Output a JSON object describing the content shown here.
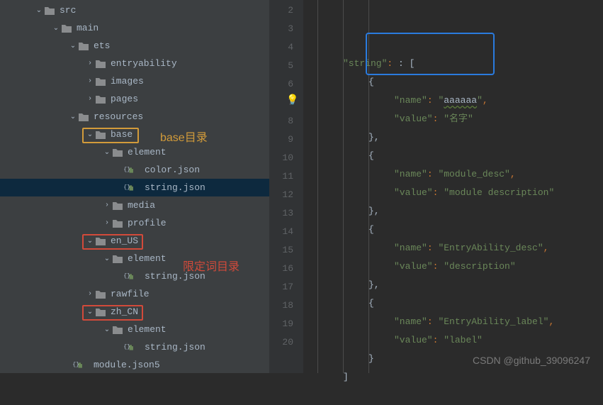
{
  "tree": {
    "rows": [
      {
        "indent": 48,
        "chev": "down",
        "icon": "folder",
        "label": "src"
      },
      {
        "indent": 72,
        "chev": "down",
        "icon": "folder",
        "label": "main"
      },
      {
        "indent": 96,
        "chev": "down",
        "icon": "folder",
        "label": "ets"
      },
      {
        "indent": 120,
        "chev": "right",
        "icon": "folder",
        "label": "entryability"
      },
      {
        "indent": 120,
        "chev": "right",
        "icon": "folder",
        "label": "images"
      },
      {
        "indent": 120,
        "chev": "right",
        "icon": "folder",
        "label": "pages"
      },
      {
        "indent": 96,
        "chev": "down",
        "icon": "folder",
        "label": "resources"
      },
      {
        "indent": 120,
        "chev": "down",
        "icon": "folder",
        "label": "base"
      },
      {
        "indent": 144,
        "chev": "down",
        "icon": "folder",
        "label": "element"
      },
      {
        "indent": 168,
        "chev": "none",
        "icon": "json",
        "label": "color.json"
      },
      {
        "indent": 168,
        "chev": "none",
        "icon": "json",
        "label": "string.json",
        "selected": true
      },
      {
        "indent": 144,
        "chev": "right",
        "icon": "folder",
        "label": "media"
      },
      {
        "indent": 144,
        "chev": "right",
        "icon": "folder",
        "label": "profile"
      },
      {
        "indent": 120,
        "chev": "down",
        "icon": "folder",
        "label": "en_US"
      },
      {
        "indent": 144,
        "chev": "down",
        "icon": "folder",
        "label": "element"
      },
      {
        "indent": 168,
        "chev": "none",
        "icon": "json",
        "label": "string.json"
      },
      {
        "indent": 120,
        "chev": "right",
        "icon": "folder",
        "label": "rawfile"
      },
      {
        "indent": 120,
        "chev": "down",
        "icon": "folder",
        "label": "zh_CN"
      },
      {
        "indent": 144,
        "chev": "down",
        "icon": "folder",
        "label": "element"
      },
      {
        "indent": 168,
        "chev": "none",
        "icon": "json",
        "label": "string.json"
      },
      {
        "indent": 96,
        "chev": "none",
        "icon": "json5",
        "label": "module.json5"
      }
    ],
    "annotations": {
      "base_label": "base目录",
      "en_us_label": "限定词目录"
    }
  },
  "editor": {
    "lines": [
      "2",
      "3",
      "4",
      "5",
      "6",
      "7",
      "8",
      "9",
      "10",
      "11",
      "12",
      "13",
      "14",
      "15",
      "16",
      "17",
      "18",
      "19",
      "20"
    ],
    "content": {
      "l2": {
        "indent": 2,
        "key": "string",
        "after": ": ["
      },
      "l3": {
        "indent": 4,
        "text": "{"
      },
      "l4": {
        "indent": 6,
        "key": "name",
        "val": "aaaaaa",
        "comma": true,
        "bulb": true,
        "selected": true
      },
      "l5": {
        "indent": 6,
        "key": "value",
        "val": "名字"
      },
      "l6": {
        "indent": 4,
        "text": "},"
      },
      "l7": {
        "indent": 4,
        "text": "{"
      },
      "l8": {
        "indent": 6,
        "key": "name",
        "val": "module_desc",
        "comma": true
      },
      "l9": {
        "indent": 6,
        "key": "value",
        "val": "module description"
      },
      "l10": {
        "indent": 4,
        "text": "},"
      },
      "l11": {
        "indent": 4,
        "text": "{"
      },
      "l12": {
        "indent": 6,
        "key": "name",
        "val": "EntryAbility_desc",
        "comma": true
      },
      "l13": {
        "indent": 6,
        "key": "value",
        "val": "description"
      },
      "l14": {
        "indent": 4,
        "text": "},"
      },
      "l15": {
        "indent": 4,
        "text": "{"
      },
      "l16": {
        "indent": 6,
        "key": "name",
        "val": "EntryAbility_label",
        "comma": true
      },
      "l17": {
        "indent": 6,
        "key": "value",
        "val": "label"
      },
      "l18": {
        "indent": 4,
        "text": "}"
      },
      "l19": {
        "indent": 2,
        "text": "]"
      },
      "l20": {
        "indent": 0,
        "text": ""
      }
    }
  },
  "watermark": "CSDN @github_39096247"
}
